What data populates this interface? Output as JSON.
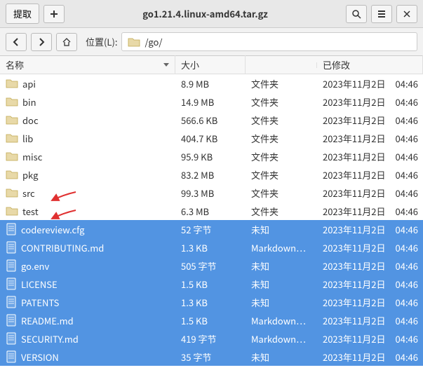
{
  "window": {
    "title": "go1.21.4.linux-amd64.tar.gz",
    "extract_label": "提取"
  },
  "nav": {
    "location_label": "位置(L):",
    "path": "/go/"
  },
  "columns": {
    "name": "名称",
    "size": "大小",
    "type": "",
    "modified": "已修改"
  },
  "rows": [
    {
      "icon": "folder",
      "name": "api",
      "size": "8.9 MB",
      "type": "文件夹",
      "date": "2023年11月2日",
      "time": "04:46",
      "selected": false
    },
    {
      "icon": "folder",
      "name": "bin",
      "size": "14.9 MB",
      "type": "文件夹",
      "date": "2023年11月2日",
      "time": "04:46",
      "selected": false
    },
    {
      "icon": "folder",
      "name": "doc",
      "size": "566.6 KB",
      "type": "文件夹",
      "date": "2023年11月2日",
      "time": "04:46",
      "selected": false
    },
    {
      "icon": "folder",
      "name": "lib",
      "size": "404.7 KB",
      "type": "文件夹",
      "date": "2023年11月2日",
      "time": "04:46",
      "selected": false
    },
    {
      "icon": "folder",
      "name": "misc",
      "size": "95.9 KB",
      "type": "文件夹",
      "date": "2023年11月2日",
      "time": "04:46",
      "selected": false
    },
    {
      "icon": "folder",
      "name": "pkg",
      "size": "83.2 MB",
      "type": "文件夹",
      "date": "2023年11月2日",
      "time": "04:46",
      "selected": false
    },
    {
      "icon": "folder",
      "name": "src",
      "size": "99.3 MB",
      "type": "文件夹",
      "date": "2023年11月2日",
      "time": "04:46",
      "selected": false
    },
    {
      "icon": "folder",
      "name": "test",
      "size": "6.3 MB",
      "type": "文件夹",
      "date": "2023年11月2日",
      "time": "04:46",
      "selected": false
    },
    {
      "icon": "file",
      "name": "codereview.cfg",
      "size": "52 字节",
      "type": "未知",
      "date": "2023年11月2日",
      "time": "04:46",
      "selected": true
    },
    {
      "icon": "file",
      "name": "CONTRIBUTING.md",
      "size": "1.3 KB",
      "type": "Markdown…",
      "date": "2023年11月2日",
      "time": "04:46",
      "selected": true
    },
    {
      "icon": "file",
      "name": "go.env",
      "size": "505 字节",
      "type": "未知",
      "date": "2023年11月2日",
      "time": "04:46",
      "selected": true
    },
    {
      "icon": "file",
      "name": "LICENSE",
      "size": "1.5 KB",
      "type": "未知",
      "date": "2023年11月2日",
      "time": "04:46",
      "selected": true
    },
    {
      "icon": "file",
      "name": "PATENTS",
      "size": "1.3 KB",
      "type": "未知",
      "date": "2023年11月2日",
      "time": "04:46",
      "selected": true
    },
    {
      "icon": "file",
      "name": "README.md",
      "size": "1.5 KB",
      "type": "Markdown…",
      "date": "2023年11月2日",
      "time": "04:46",
      "selected": true
    },
    {
      "icon": "file",
      "name": "SECURITY.md",
      "size": "419 字节",
      "type": "Markdown…",
      "date": "2023年11月2日",
      "time": "04:46",
      "selected": true
    },
    {
      "icon": "file",
      "name": "VERSION",
      "size": "35 字节",
      "type": "未知",
      "date": "2023年11月2日",
      "time": "04:46",
      "selected": true
    }
  ]
}
